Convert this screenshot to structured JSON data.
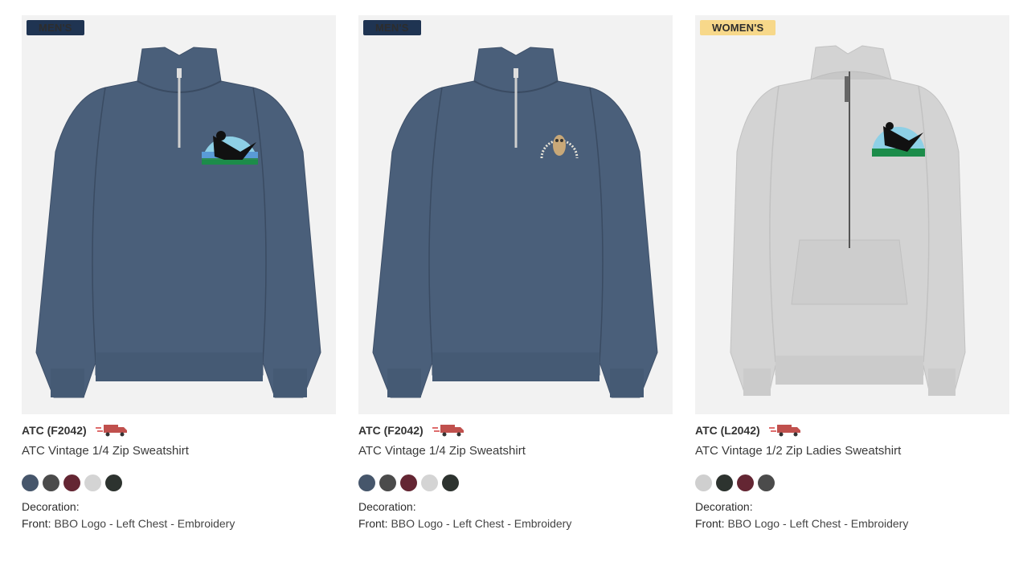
{
  "products": [
    {
      "badge": "MEN'S",
      "badge_type": "mens",
      "sku": "ATC (F2042)",
      "title": "ATC Vintage 1/4 Zip Sweatshirt",
      "price": "",
      "garment": "heather-navy",
      "logo": "bird-logo-green",
      "swatches": [
        "#46566b",
        "#4b4b4b",
        "#642633",
        "#d4d4d4",
        "#2d332f"
      ],
      "decoration_label": "Decoration:",
      "decoration_key": "Front:",
      "decoration_value": "BBO Logo - Left Chest - Embroidery"
    },
    {
      "badge": "MEN'S",
      "badge_type": "mens",
      "sku": "ATC (F2042)",
      "title": "ATC Vintage 1/4 Zip Sweatshirt",
      "price": "",
      "garment": "heather-navy",
      "logo": "owl-logo",
      "swatches": [
        "#46566b",
        "#4b4b4b",
        "#642633",
        "#d4d4d4",
        "#2d332f"
      ],
      "decoration_label": "Decoration:",
      "decoration_key": "Front:",
      "decoration_value": "BBO Logo - Left Chest - Embroidery"
    },
    {
      "badge": "WOMEN'S",
      "badge_type": "womens",
      "sku": "ATC (L2042)",
      "title": "ATC Vintage 1/2 Zip Ladies Sweatshirt",
      "price": "",
      "garment": "heather-grey",
      "logo": "bird-logo-green",
      "swatches": [
        "#cfcfcf",
        "#2d332f",
        "#642633",
        "#4b4b4b"
      ],
      "decoration_label": "Decoration:",
      "decoration_key": "Front:",
      "decoration_value": "BBO Logo - Left Chest - Embroidery"
    }
  ],
  "icons": {
    "shipping": "delivery-truck-icon"
  },
  "colors": {
    "badge_mens": "#1f3452",
    "badge_womens": "#f7d88a",
    "image_bg": "#f2f2f2"
  }
}
